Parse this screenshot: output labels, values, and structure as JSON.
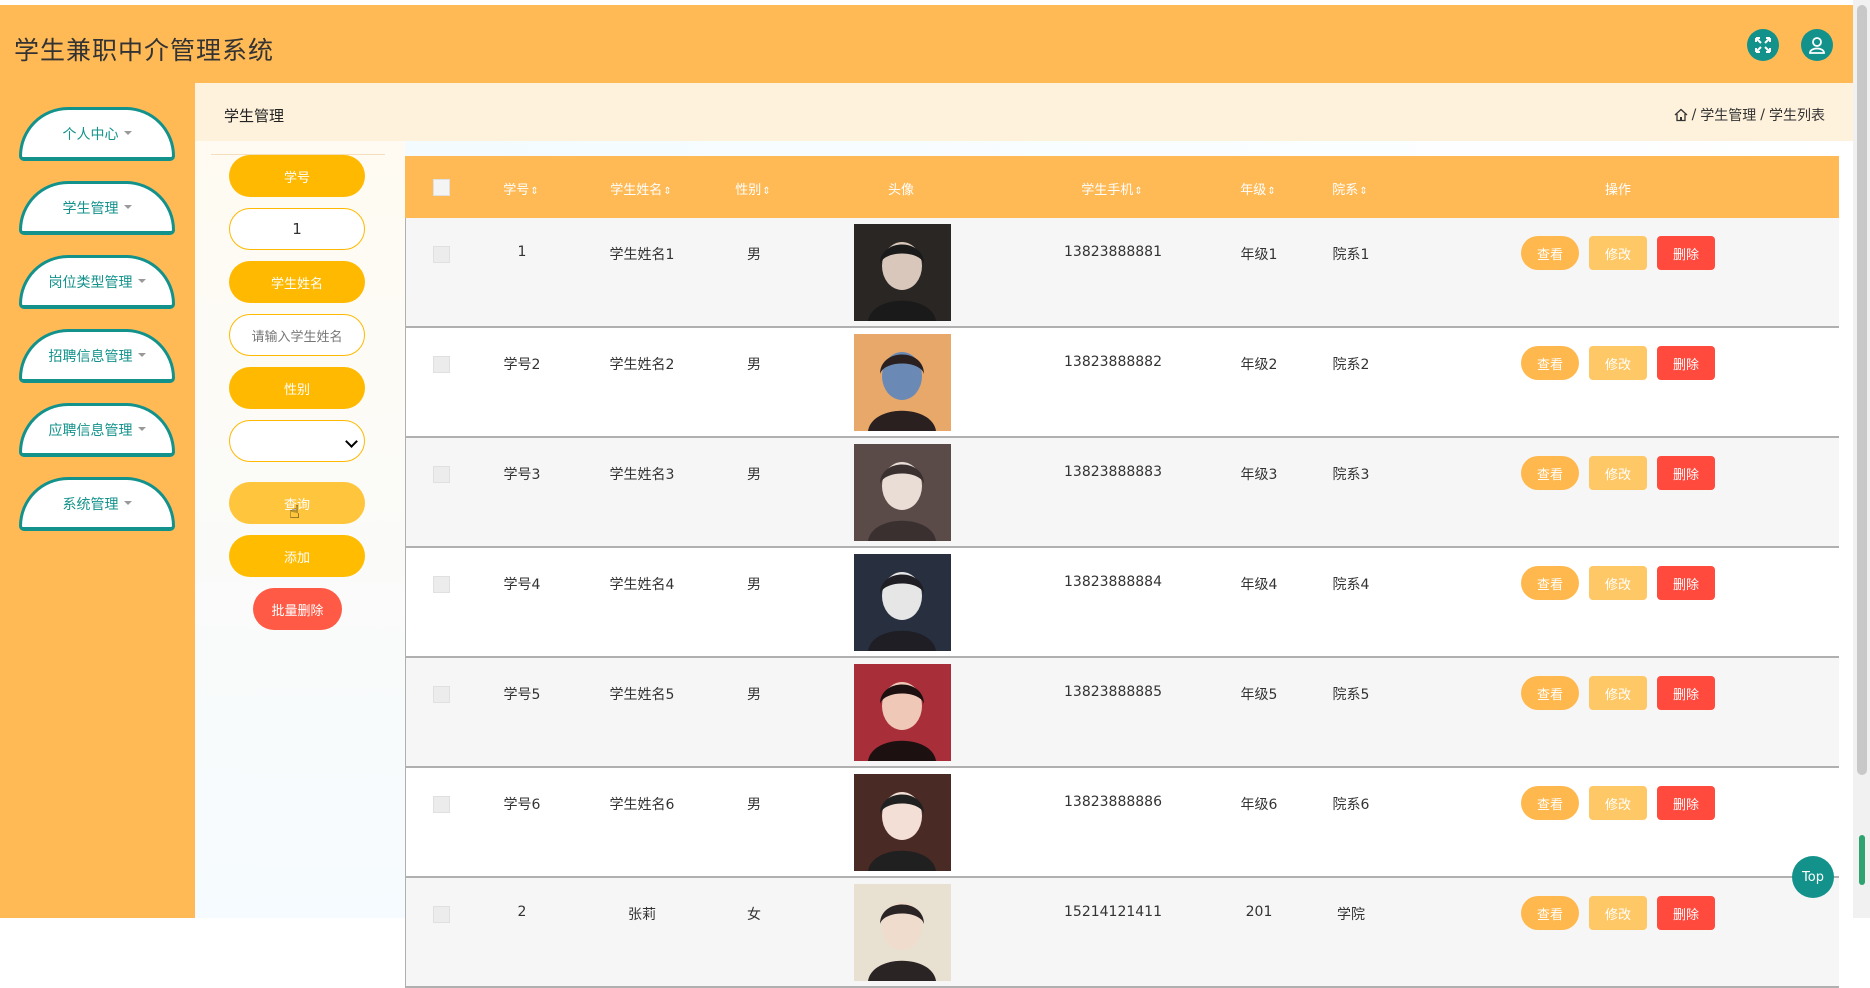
{
  "app": {
    "title": "学生兼职中介管理系统"
  },
  "topbar": {
    "fullscreen_icon": "expand-icon",
    "user_icon": "user-icon"
  },
  "sidebar": {
    "items": [
      {
        "label": "个人中心"
      },
      {
        "label": "学生管理"
      },
      {
        "label": "岗位类型管理"
      },
      {
        "label": "招聘信息管理"
      },
      {
        "label": "应聘信息管理"
      },
      {
        "label": "系统管理"
      }
    ]
  },
  "header": {
    "title": "学生管理",
    "breadcrumb": [
      "学生管理",
      "学生列表"
    ],
    "separator": "/"
  },
  "search": {
    "student_no_label": "学号",
    "student_no_value": "1",
    "student_name_label": "学生姓名",
    "student_name_placeholder": "请输入学生姓名",
    "gender_label": "性别",
    "gender_value": "",
    "query_label": "查询",
    "add_label": "添加",
    "batch_delete_label": "批量删除"
  },
  "table": {
    "columns": [
      "学号",
      "学生姓名",
      "性别",
      "头像",
      "学生手机",
      "年级",
      "院系",
      "操作"
    ],
    "rows": [
      {
        "no": "1",
        "name": "学生姓名1",
        "gender": "男",
        "phone": "13823888881",
        "grade": "年级1",
        "dept": "院系1"
      },
      {
        "no": "学号2",
        "name": "学生姓名2",
        "gender": "男",
        "phone": "13823888882",
        "grade": "年级2",
        "dept": "院系2"
      },
      {
        "no": "学号3",
        "name": "学生姓名3",
        "gender": "男",
        "phone": "13823888883",
        "grade": "年级3",
        "dept": "院系3"
      },
      {
        "no": "学号4",
        "name": "学生姓名4",
        "gender": "男",
        "phone": "13823888884",
        "grade": "年级4",
        "dept": "院系4"
      },
      {
        "no": "学号5",
        "name": "学生姓名5",
        "gender": "男",
        "phone": "13823888885",
        "grade": "年级5",
        "dept": "院系5"
      },
      {
        "no": "学号6",
        "name": "学生姓名6",
        "gender": "男",
        "phone": "13823888886",
        "grade": "年级6",
        "dept": "院系6"
      },
      {
        "no": "2",
        "name": "张莉",
        "gender": "女",
        "phone": "15214121411",
        "grade": "201",
        "dept": "学院"
      }
    ],
    "actions": {
      "view": "查看",
      "edit": "修改",
      "delete": "删除"
    }
  },
  "top_button": {
    "label": "Top"
  },
  "colors": {
    "primary": "#ffba56",
    "accent": "#13928b",
    "danger": "#ff4a3d"
  }
}
